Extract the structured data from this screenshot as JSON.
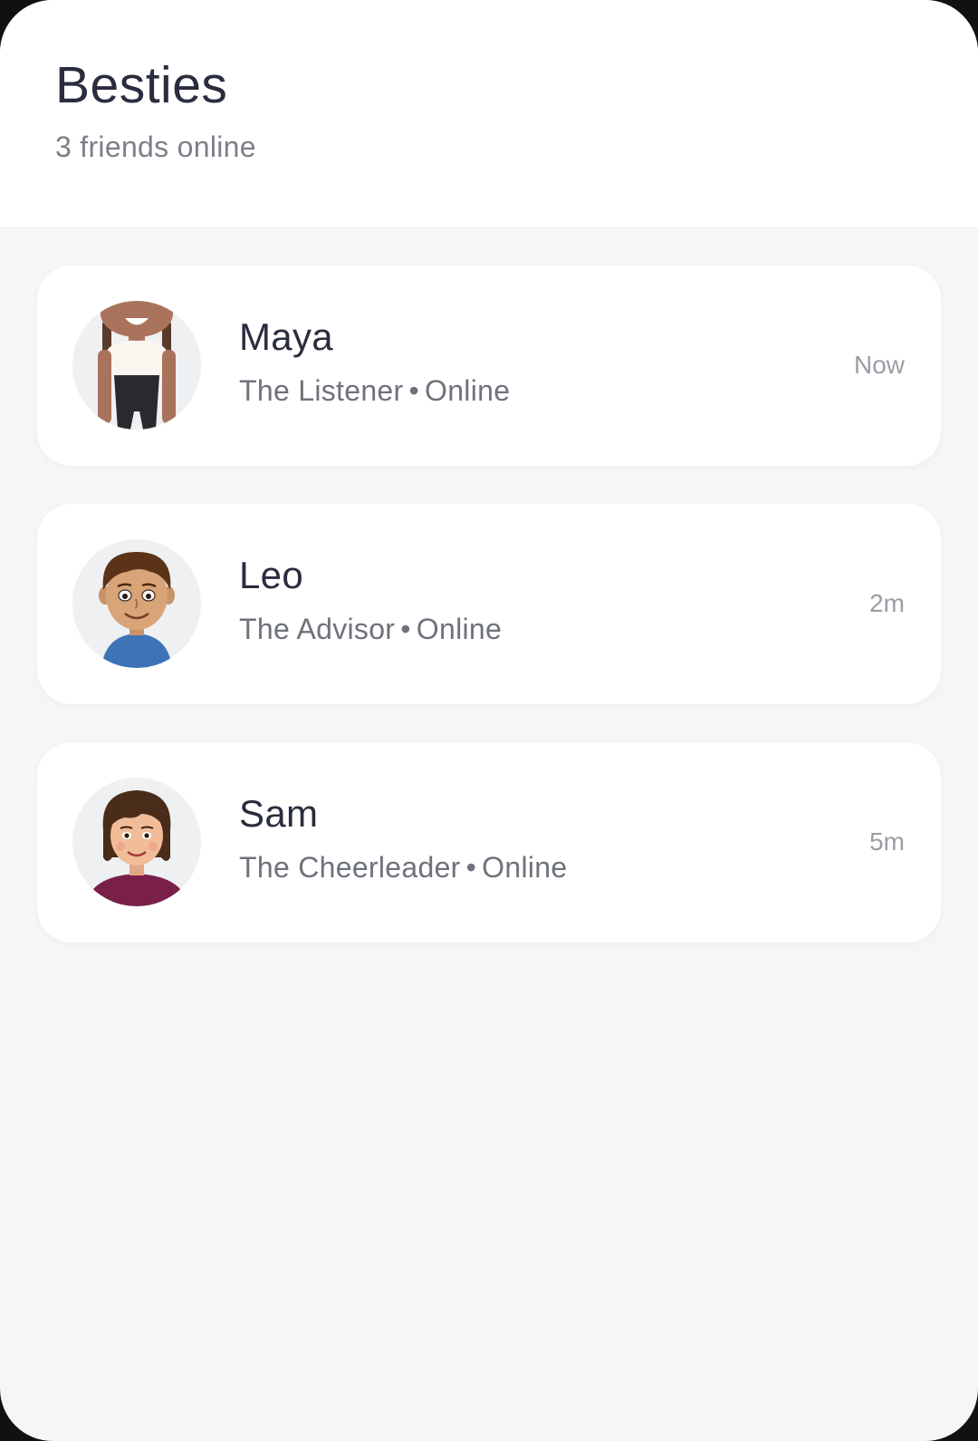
{
  "header": {
    "title": "Besties",
    "subtitle": "3 friends online"
  },
  "friends": [
    {
      "name": "Maya",
      "role": "The Listener",
      "status": "Online",
      "time": "Now",
      "avatar_icon": "maya-avatar"
    },
    {
      "name": "Leo",
      "role": "The Advisor",
      "status": "Online",
      "time": "2m",
      "avatar_icon": "leo-avatar"
    },
    {
      "name": "Sam",
      "role": "The Cheerleader",
      "status": "Online",
      "time": "5m",
      "avatar_icon": "sam-avatar"
    }
  ],
  "separator": "•",
  "colors": {
    "background": "#f5f6f8",
    "card": "#ffffff",
    "title_text": "#2a2d3e",
    "secondary_text": "#6e727b",
    "time_text": "#9a9da5"
  }
}
